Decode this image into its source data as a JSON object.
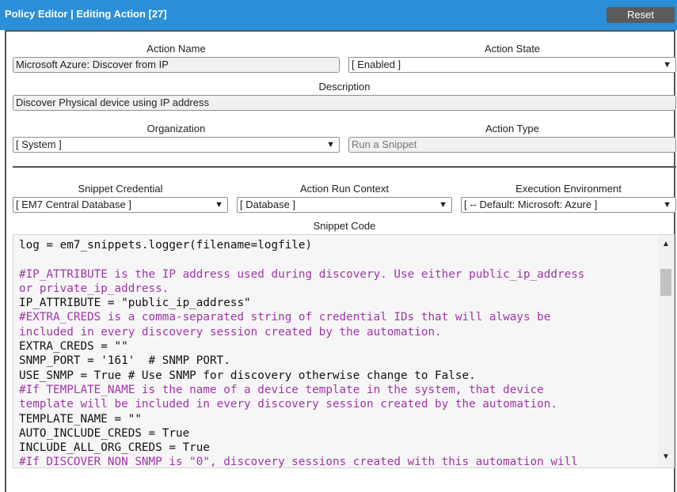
{
  "header": {
    "title": "Policy Editor | Editing Action [27]",
    "reset_label": "Reset"
  },
  "form": {
    "action_name_label": "Action Name",
    "action_name_value": "Microsoft Azure: Discover from IP",
    "action_state_label": "Action State",
    "action_state_value": "[ Enabled ]",
    "description_label": "Description",
    "description_value": "Discover Physical device using IP address",
    "organization_label": "Organization",
    "organization_value": "[ System ]",
    "action_type_label": "Action Type",
    "action_type_placeholder": "Run a Snippet",
    "snippet_credential_label": "Snippet Credential",
    "snippet_credential_value": "[ EM7 Central Database ]",
    "run_context_label": "Action Run Context",
    "run_context_value": "[ Database ]",
    "exec_env_label": "Execution Environment",
    "exec_env_value": "[ -- Default: Microsoft: Azure ]",
    "snippet_code_label": "Snippet Code"
  },
  "code_lines": [
    {
      "text": "log = em7_snippets.logger(filename=logfile)",
      "kind": "code"
    },
    {
      "text": "",
      "kind": "code"
    },
    {
      "text": "#IP_ATTRIBUTE is the IP address used during discovery. Use either public_ip_address",
      "kind": "comment"
    },
    {
      "text": "or private_ip_address.",
      "kind": "comment"
    },
    {
      "text": "IP_ATTRIBUTE = \"public_ip_address\"",
      "kind": "code"
    },
    {
      "text": "#EXTRA_CREDS is a comma-separated string of credential IDs that will always be",
      "kind": "comment"
    },
    {
      "text": "included in every discovery session created by the automation.",
      "kind": "comment"
    },
    {
      "text": "EXTRA_CREDS = \"\"",
      "kind": "code"
    },
    {
      "text": "SNMP_PORT = '161'  # SNMP PORT.",
      "kind": "code"
    },
    {
      "text": "USE_SNMP = True # Use SNMP for discovery otherwise change to False.",
      "kind": "code"
    },
    {
      "text": "#If TEMPLATE_NAME is the name of a device template in the system, that device",
      "kind": "comment"
    },
    {
      "text": "template will be included in every discovery session created by the automation.",
      "kind": "comment"
    },
    {
      "text": "TEMPLATE_NAME = \"\"",
      "kind": "code"
    },
    {
      "text": "AUTO_INCLUDE_CREDS = True",
      "kind": "code"
    },
    {
      "text": "INCLUDE_ALL_ORG_CREDS = True",
      "kind": "code"
    },
    {
      "text": "#If DISCOVER_NON_SNMP is \"0\", discovery sessions created with this automation will",
      "kind": "comment"
    }
  ]
}
